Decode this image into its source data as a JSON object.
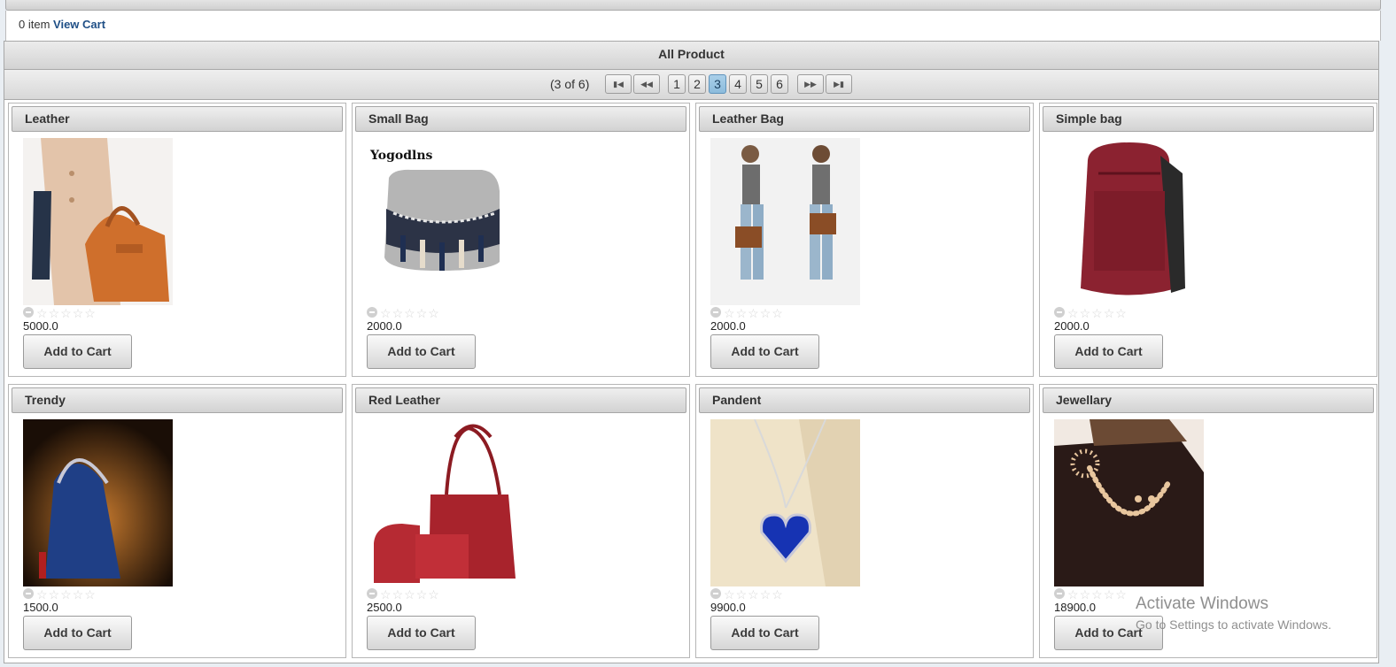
{
  "cart": {
    "count_text": "0 item",
    "link_label": "View Cart"
  },
  "panel": {
    "title": "All Product"
  },
  "paginator": {
    "report": "(3 of 6)",
    "first_icon": "first-page-icon",
    "prev_icon": "prev-page-icon",
    "next_icon": "next-page-icon",
    "last_icon": "last-page-icon",
    "pages": [
      "1",
      "2",
      "3",
      "4",
      "5",
      "6"
    ],
    "current_page": "3"
  },
  "rating": {
    "max_stars": 5,
    "value": 0,
    "cancel_icon": "cancel-rating-icon",
    "star_icon": "star-icon"
  },
  "products": [
    {
      "name": "Leather",
      "price": "5000.0",
      "image": "beige coat with orange leather handbag",
      "button": "Add to Cart"
    },
    {
      "name": "Small Bag",
      "price": "2000.0",
      "image": "grey tassel crossbody bag",
      "button": "Add to Cart",
      "image_text": "Yogodlns"
    },
    {
      "name": "Leather Bag",
      "price": "2000.0",
      "image": "two models with brown leather bags",
      "button": "Add to Cart"
    },
    {
      "name": "Simple bag",
      "price": "2000.0",
      "image": "maroon backpack",
      "button": "Add to Cart"
    },
    {
      "name": "Trendy",
      "price": "1500.0",
      "image": "navy blue handbag on dark background",
      "button": "Add to Cart"
    },
    {
      "name": "Red Leather",
      "price": "2500.0",
      "image": "red leather bag set",
      "button": "Add to Cart"
    },
    {
      "name": "Pandent",
      "price": "9900.0",
      "image": "blue heart pendant necklace",
      "button": "Add to Cart"
    },
    {
      "name": "Jewellary",
      "price": "18900.0",
      "image": "pearl jewellery set in box",
      "button": "Add to Cart"
    }
  ],
  "watermark": {
    "line1": "Activate Windows",
    "line2": "Go to Settings to activate Windows."
  }
}
